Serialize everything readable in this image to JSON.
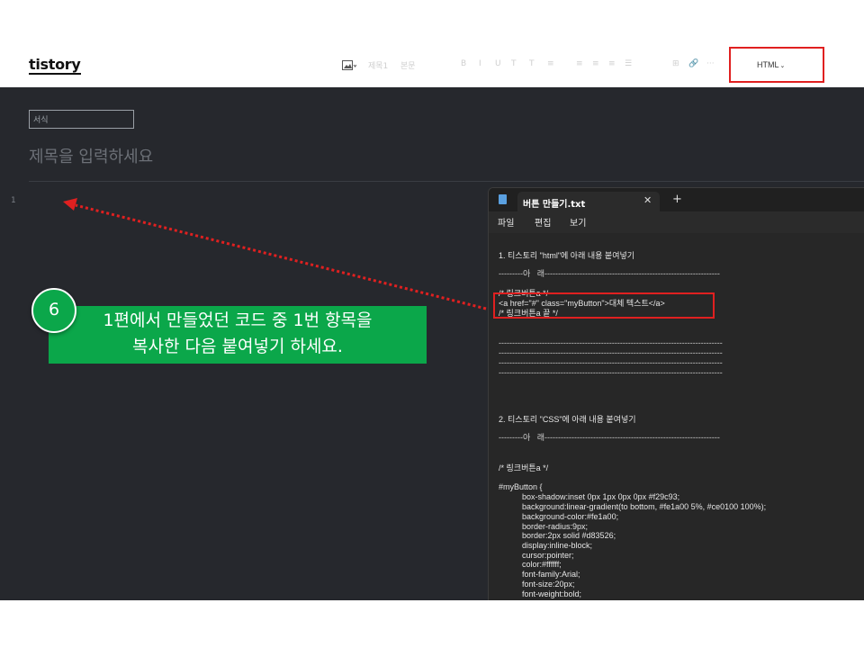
{
  "app": {
    "logo": "tistory"
  },
  "toolbar": {
    "image_icon": "image-icon",
    "faint_labels": [
      "제목1",
      "본문",
      "B",
      "I",
      "U",
      "T",
      "T",
      "≡",
      "≡",
      "≡",
      "≡",
      "☰",
      "⊞",
      "🔗",
      "···"
    ],
    "html_mode_label": "HTML",
    "html_mode_chevron": "chevron-down-icon"
  },
  "editor": {
    "format_select": "서식",
    "title_placeholder": "제목을 입력하세요",
    "line_number": "1"
  },
  "notepad": {
    "tab_title": "버튼 만들기.txt",
    "close": "✕",
    "new_tab": "+",
    "menu": [
      "파일",
      "편집",
      "보기"
    ],
    "lines": [
      "1. 티스토리 \"html\"에 아래 내용 붙여넣기",
      "---------아   래-----------------------------------------------------------------",
      "/* 링크버튼a */",
      "<a href=\"#\" class=\"myButton\">대체 텍스트</a>",
      "/* 링크버튼a 끝 */",
      "-----------------------------------------------------------------------------------",
      "-----------------------------------------------------------------------------------",
      "-----------------------------------------------------------------------------------",
      "-----------------------------------------------------------------------------------",
      "2. 티스토리 \"CSS\"에 아래 내용 붙여넣기",
      "---------아   래-----------------------------------------------------------------",
      "/* 링크버튼a */",
      "#myButton {",
      "box-shadow:inset 0px 1px 0px 0px #f29c93;",
      "background:linear-gradient(to bottom, #fe1a00 5%, #ce0100 100%);",
      "background-color:#fe1a00;",
      "border-radius:9px;",
      "border:2px solid #d83526;",
      "display:inline-block;",
      "cursor:pointer;",
      "color:#ffffff;",
      "font-family:Arial;",
      "font-size:20px;",
      "font-weight:bold;"
    ]
  },
  "annotation": {
    "step_number": "6",
    "instruction_line1": "1편에서 만들었던 코드 중 1번 항목을",
    "instruction_line2": "복사한 다음 붙여넣기 하세요.",
    "highlight_color": "#e02020",
    "callout_color": "#0ba74a"
  }
}
